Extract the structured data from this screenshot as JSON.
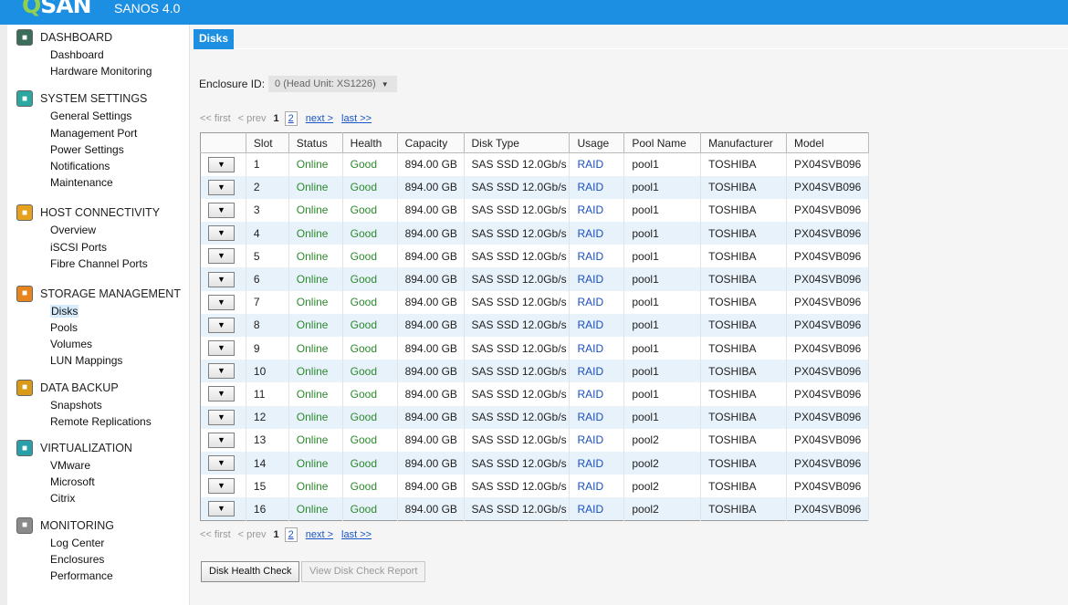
{
  "header": {
    "logo_prefix": "Q",
    "logo_rest": "SAN",
    "product": "SANOS 4.0"
  },
  "sidebar": {
    "sections": [
      {
        "title": "DASHBOARD",
        "icon": "dashboard-icon",
        "color": "#3a6e5b",
        "items": [
          "Dashboard",
          "Hardware Monitoring"
        ]
      },
      {
        "title": "SYSTEM SETTINGS",
        "icon": "settings-icon",
        "color": "#2aa7a0",
        "items": [
          "General Settings",
          "Management Port",
          "Power Settings",
          "Notifications",
          "Maintenance"
        ]
      },
      {
        "title": "HOST CONNECTIVITY",
        "icon": "connectivity-icon",
        "color": "#e8a11c",
        "items": [
          "Overview",
          "iSCSI Ports",
          "Fibre Channel Ports"
        ]
      },
      {
        "title": "STORAGE MANAGEMENT",
        "icon": "storage-icon",
        "color": "#e8841c",
        "items": [
          "Disks",
          "Pools",
          "Volumes",
          "LUN Mappings"
        ]
      },
      {
        "title": "DATA BACKUP",
        "icon": "backup-icon",
        "color": "#d99a17",
        "items": [
          "Snapshots",
          "Remote Replications"
        ]
      },
      {
        "title": "VIRTUALIZATION",
        "icon": "virtualization-icon",
        "color": "#29a0a9",
        "items": [
          "VMware",
          "Microsoft",
          "Citrix"
        ]
      },
      {
        "title": "MONITORING",
        "icon": "monitoring-icon",
        "color": "#8a8a8a",
        "items": [
          "Log Center",
          "Enclosures",
          "Performance"
        ]
      }
    ],
    "active_item": "Disks"
  },
  "main": {
    "tab": "Disks",
    "enclosure_label": "Enclosure ID:",
    "enclosure_value": "0 (Head Unit: XS1226)",
    "pager": {
      "first": "<< first",
      "prev": "< prev",
      "current": "1",
      "page2": "2",
      "next": "next >",
      "last": "last >>"
    },
    "columns": [
      "",
      "Slot",
      "Status",
      "Health",
      "Capacity",
      "Disk Type",
      "Usage",
      "Pool Name",
      "Manufacturer",
      "Model"
    ],
    "rows": [
      {
        "slot": "1",
        "status": "Online",
        "health": "Good",
        "capacity": "894.00 GB",
        "type": "SAS SSD 12.0Gb/s",
        "usage": "RAID",
        "pool": "pool1",
        "mfr": "TOSHIBA",
        "model": "PX04SVB096"
      },
      {
        "slot": "2",
        "status": "Online",
        "health": "Good",
        "capacity": "894.00 GB",
        "type": "SAS SSD 12.0Gb/s",
        "usage": "RAID",
        "pool": "pool1",
        "mfr": "TOSHIBA",
        "model": "PX04SVB096"
      },
      {
        "slot": "3",
        "status": "Online",
        "health": "Good",
        "capacity": "894.00 GB",
        "type": "SAS SSD 12.0Gb/s",
        "usage": "RAID",
        "pool": "pool1",
        "mfr": "TOSHIBA",
        "model": "PX04SVB096"
      },
      {
        "slot": "4",
        "status": "Online",
        "health": "Good",
        "capacity": "894.00 GB",
        "type": "SAS SSD 12.0Gb/s",
        "usage": "RAID",
        "pool": "pool1",
        "mfr": "TOSHIBA",
        "model": "PX04SVB096"
      },
      {
        "slot": "5",
        "status": "Online",
        "health": "Good",
        "capacity": "894.00 GB",
        "type": "SAS SSD 12.0Gb/s",
        "usage": "RAID",
        "pool": "pool1",
        "mfr": "TOSHIBA",
        "model": "PX04SVB096"
      },
      {
        "slot": "6",
        "status": "Online",
        "health": "Good",
        "capacity": "894.00 GB",
        "type": "SAS SSD 12.0Gb/s",
        "usage": "RAID",
        "pool": "pool1",
        "mfr": "TOSHIBA",
        "model": "PX04SVB096"
      },
      {
        "slot": "7",
        "status": "Online",
        "health": "Good",
        "capacity": "894.00 GB",
        "type": "SAS SSD 12.0Gb/s",
        "usage": "RAID",
        "pool": "pool1",
        "mfr": "TOSHIBA",
        "model": "PX04SVB096"
      },
      {
        "slot": "8",
        "status": "Online",
        "health": "Good",
        "capacity": "894.00 GB",
        "type": "SAS SSD 12.0Gb/s",
        "usage": "RAID",
        "pool": "pool1",
        "mfr": "TOSHIBA",
        "model": "PX04SVB096"
      },
      {
        "slot": "9",
        "status": "Online",
        "health": "Good",
        "capacity": "894.00 GB",
        "type": "SAS SSD 12.0Gb/s",
        "usage": "RAID",
        "pool": "pool1",
        "mfr": "TOSHIBA",
        "model": "PX04SVB096"
      },
      {
        "slot": "10",
        "status": "Online",
        "health": "Good",
        "capacity": "894.00 GB",
        "type": "SAS SSD 12.0Gb/s",
        "usage": "RAID",
        "pool": "pool1",
        "mfr": "TOSHIBA",
        "model": "PX04SVB096"
      },
      {
        "slot": "11",
        "status": "Online",
        "health": "Good",
        "capacity": "894.00 GB",
        "type": "SAS SSD 12.0Gb/s",
        "usage": "RAID",
        "pool": "pool1",
        "mfr": "TOSHIBA",
        "model": "PX04SVB096"
      },
      {
        "slot": "12",
        "status": "Online",
        "health": "Good",
        "capacity": "894.00 GB",
        "type": "SAS SSD 12.0Gb/s",
        "usage": "RAID",
        "pool": "pool1",
        "mfr": "TOSHIBA",
        "model": "PX04SVB096"
      },
      {
        "slot": "13",
        "status": "Online",
        "health": "Good",
        "capacity": "894.00 GB",
        "type": "SAS SSD 12.0Gb/s",
        "usage": "RAID",
        "pool": "pool2",
        "mfr": "TOSHIBA",
        "model": "PX04SVB096"
      },
      {
        "slot": "14",
        "status": "Online",
        "health": "Good",
        "capacity": "894.00 GB",
        "type": "SAS SSD 12.0Gb/s",
        "usage": "RAID",
        "pool": "pool2",
        "mfr": "TOSHIBA",
        "model": "PX04SVB096"
      },
      {
        "slot": "15",
        "status": "Online",
        "health": "Good",
        "capacity": "894.00 GB",
        "type": "SAS SSD 12.0Gb/s",
        "usage": "RAID",
        "pool": "pool2",
        "mfr": "TOSHIBA",
        "model": "PX04SVB096"
      },
      {
        "slot": "16",
        "status": "Online",
        "health": "Good",
        "capacity": "894.00 GB",
        "type": "SAS SSD 12.0Gb/s",
        "usage": "RAID",
        "pool": "pool2",
        "mfr": "TOSHIBA",
        "model": "PX04SVB096"
      }
    ],
    "buttons": {
      "health_check": "Disk Health Check",
      "view_report": "View Disk Check Report"
    }
  }
}
